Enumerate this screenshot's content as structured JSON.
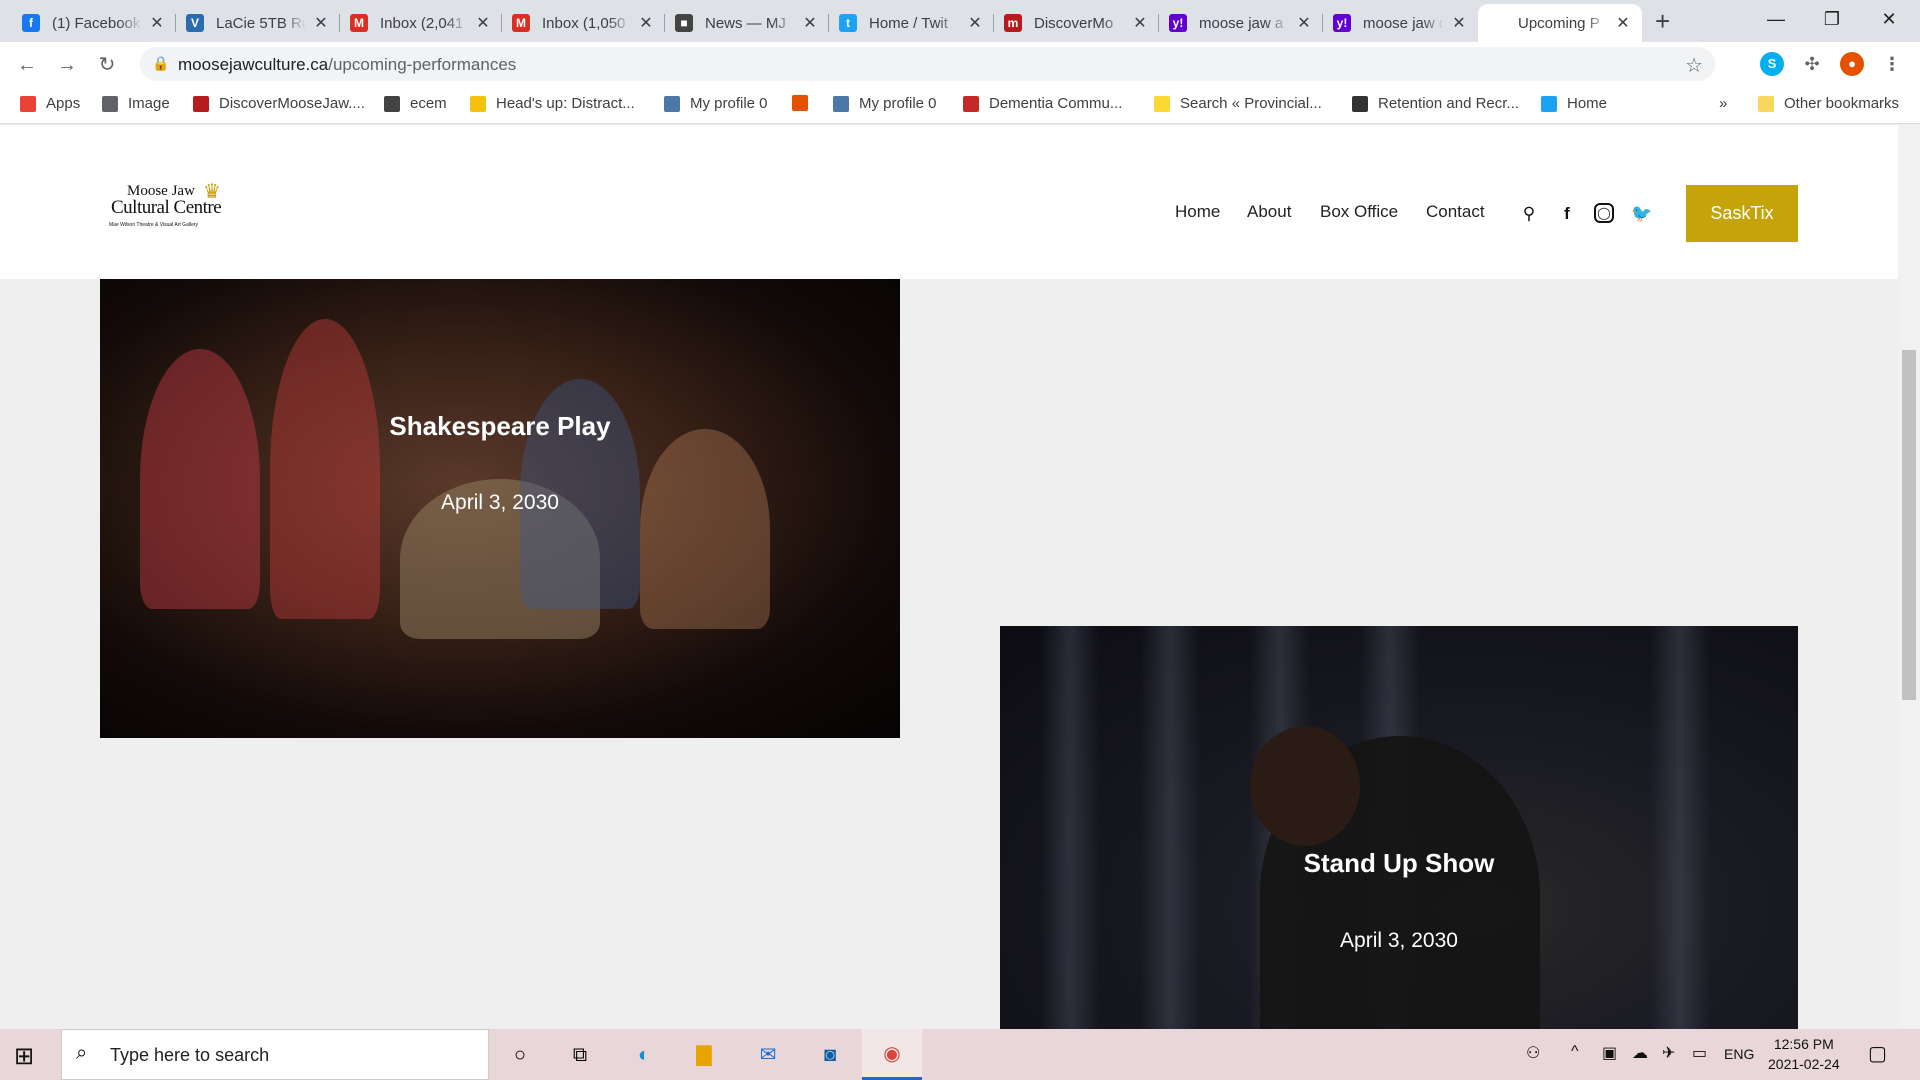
{
  "browser": {
    "tabs": [
      {
        "title": "(1) Facebook",
        "icon": "facebook-icon",
        "color": "#1877f2",
        "glyph": "f"
      },
      {
        "title": "LaCie 5TB Ru",
        "icon": "vertical-icon",
        "color": "#2b6cb0",
        "glyph": "V"
      },
      {
        "title": "Inbox (2,041",
        "icon": "gmail-icon",
        "color": "#d93025",
        "glyph": "M"
      },
      {
        "title": "Inbox (1,050",
        "icon": "gmail-icon",
        "color": "#d93025",
        "glyph": "M"
      },
      {
        "title": "News — MJ",
        "icon": "cube-icon",
        "color": "#444444",
        "glyph": "■"
      },
      {
        "title": "Home / Twit",
        "icon": "twitter-icon",
        "color": "#1da1f2",
        "glyph": "t"
      },
      {
        "title": "DiscoverMo",
        "icon": "moose-icon",
        "color": "#b71c1c",
        "glyph": "m"
      },
      {
        "title": "moose jaw a",
        "icon": "yahoo-icon",
        "color": "#6001d2",
        "glyph": "y!"
      },
      {
        "title": "moose jaw c",
        "icon": "yahoo-icon",
        "color": "#6001d2",
        "glyph": "y!"
      },
      {
        "title": "Upcoming P",
        "icon": "blank-icon",
        "color": "#ffffff",
        "glyph": ""
      }
    ],
    "url_host": "moosejawculture.ca",
    "url_path": "/upcoming-performances",
    "bookmarks": [
      {
        "label": "Apps",
        "color": "#ea4335"
      },
      {
        "label": "Image",
        "color": "#5f6368"
      },
      {
        "label": "DiscoverMooseJaw....",
        "color": "#b71c1c"
      },
      {
        "label": "ecem",
        "color": "#444444"
      },
      {
        "label": "Head's up: Distract...",
        "color": "#f4c20d"
      },
      {
        "label": "My profile 0",
        "color": "#4a76a8"
      },
      {
        "label": "",
        "color": "#e65100"
      },
      {
        "label": "My profile 0",
        "color": "#4a76a8"
      },
      {
        "label": "Dementia  Commu...",
        "color": "#c62828"
      },
      {
        "label": "Search « Provincial...",
        "color": "#fdd835"
      },
      {
        "label": "Retention and Recr...",
        "color": "#333333"
      },
      {
        "label": "Home",
        "color": "#1da1f2"
      }
    ],
    "bookmarks_more": "»",
    "other_bookmarks": "Other bookmarks"
  },
  "site": {
    "logo_line1": "Moose Jaw",
    "logo_line2": "Cultural Centre",
    "logo_line3": "Mae Wilson Theatre & Visual Art Gallery",
    "nav": [
      "Home",
      "About",
      "Box Office",
      "Contact"
    ],
    "social_icons": [
      "map-pin-icon",
      "facebook-icon",
      "instagram-icon",
      "twitter-icon"
    ],
    "cta_label": "SaskTix",
    "accent": "#c4a40a"
  },
  "performances": [
    {
      "title": "Shakespeare Play",
      "date": "April 3, 2030"
    },
    {
      "title": "Stand Up Show",
      "date": "April 3, 2030"
    }
  ],
  "taskbar": {
    "search_placeholder": "Type here to search",
    "language": "ENG",
    "time": "12:56 PM",
    "date": "2021-02-24"
  }
}
